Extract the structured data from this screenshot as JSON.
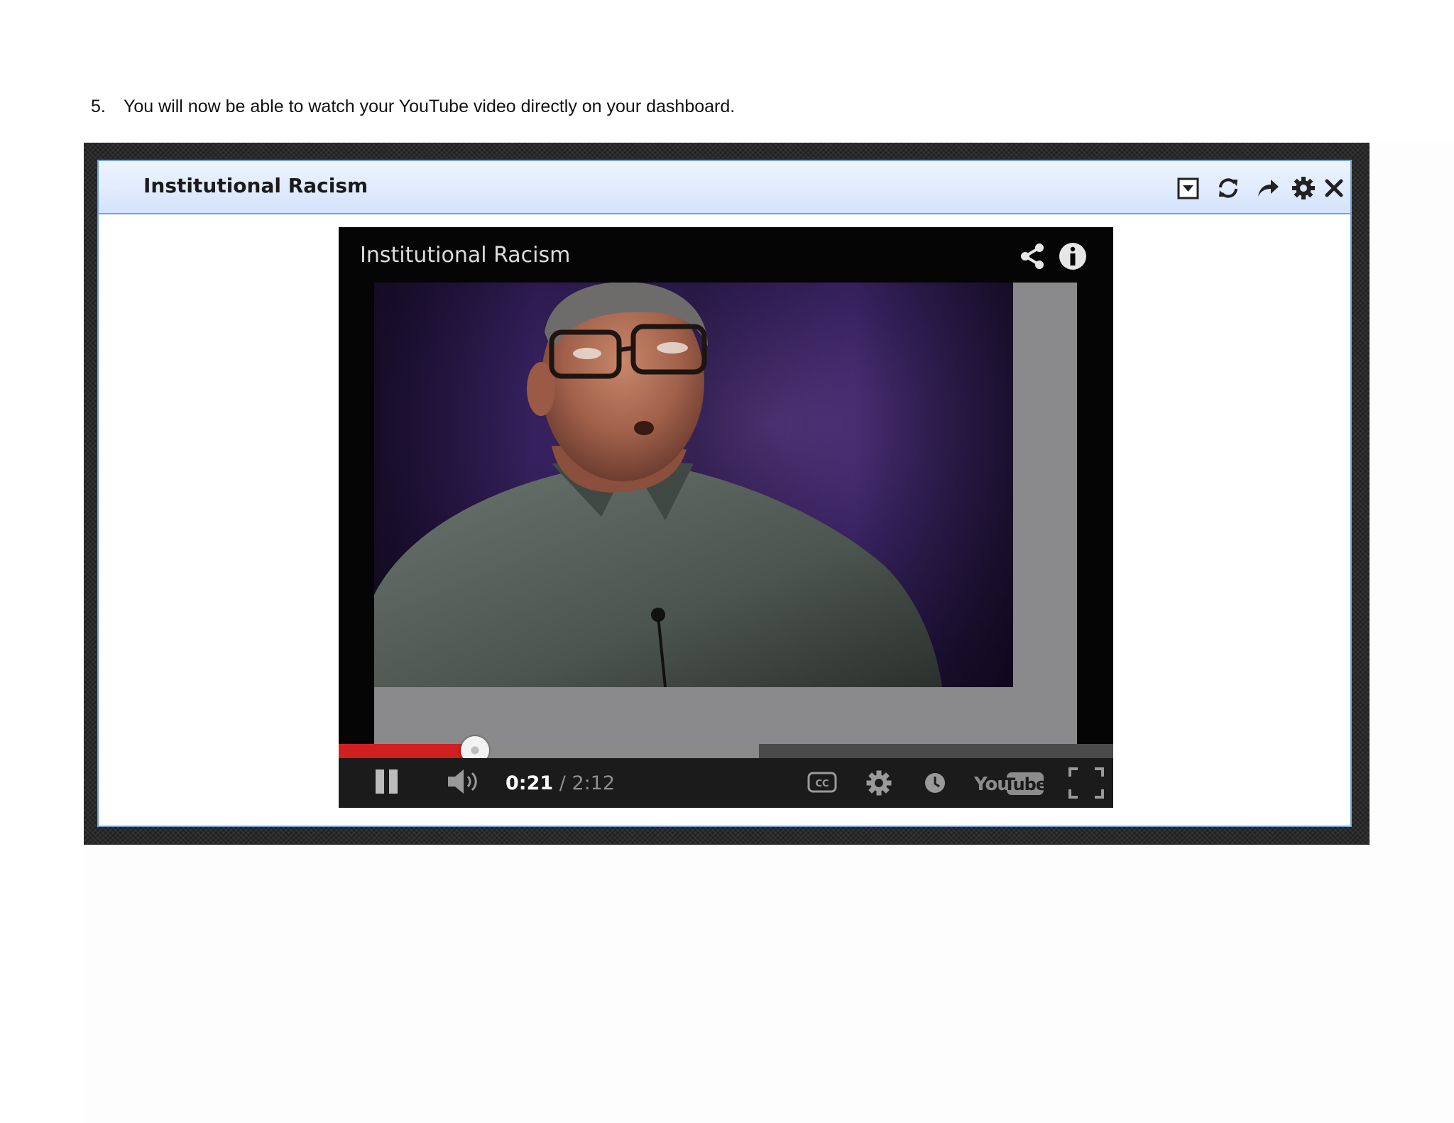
{
  "instruction": {
    "number": "5.",
    "text": "You will now be able to watch your YouTube video directly on your dashboard."
  },
  "widget": {
    "title": "Institutional Racism",
    "header_icons": [
      "dropdown-icon",
      "refresh-icon",
      "share-arrow-icon",
      "gear-icon",
      "close-icon"
    ]
  },
  "player": {
    "video_title": "Institutional Racism",
    "top_icons": [
      "share-icon",
      "info-icon"
    ],
    "time_current": "0:21",
    "time_total": "/ 2:12",
    "progress_played_fraction": 0.176,
    "progress_buffered_fraction": 0.543,
    "control_icons": [
      "pause-icon",
      "volume-icon",
      "captions-icon",
      "settings-icon",
      "watch-later-icon",
      "youtube-logo",
      "fullscreen-icon"
    ],
    "colors": {
      "progress_played": "#d01f1f",
      "header_gradient_top": "#eef4ff",
      "header_gradient_bottom": "#d4e3fb",
      "widget_border": "#6fa3dc"
    }
  }
}
